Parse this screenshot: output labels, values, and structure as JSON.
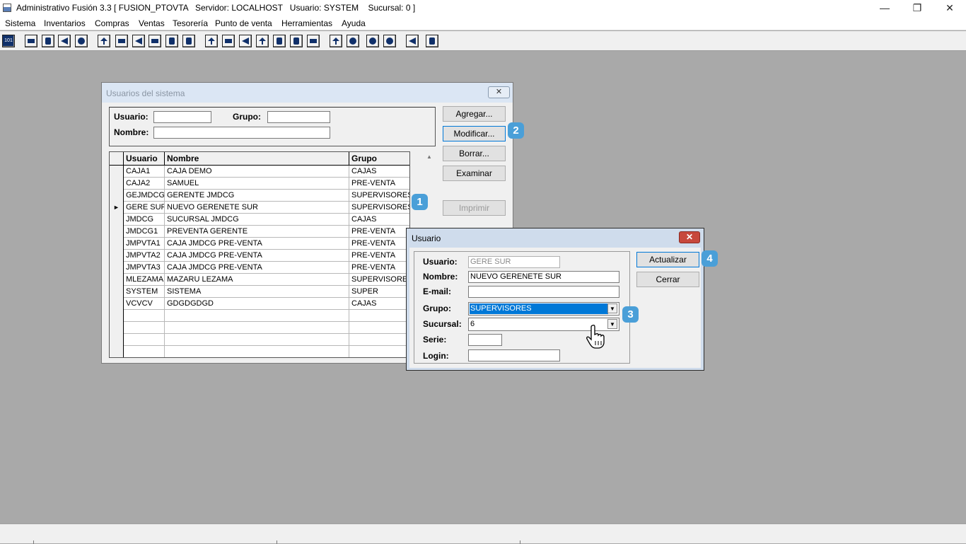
{
  "app": {
    "title": "Administrativo Fusión 3.3 [ FUSION_PTOVTA   Servidor: LOCALHOST   Usuario: SYSTEM    Sucursal: 0 ]",
    "window_controls": {
      "minimize": "—",
      "restore": "❐",
      "close": "✕"
    }
  },
  "menu": [
    "Sistema",
    "Inventarios",
    "Compras",
    "Ventas",
    "Tesorería",
    "Punto de venta",
    "Herramientas",
    "Ayuda"
  ],
  "toolbar": {
    "first_icon": "101"
  },
  "usuarios_window": {
    "title": "Usuarios del sistema",
    "close": "✕",
    "filter": {
      "usuario_label": "Usuario:",
      "usuario_value": "",
      "grupo_label": "Grupo:",
      "grupo_value": "",
      "nombre_label": "Nombre:",
      "nombre_value": ""
    },
    "buttons": {
      "agregar": "Agregar...",
      "modificar": "Modificar...",
      "borrar": "Borrar...",
      "examinar": "Examinar",
      "imprimir": "Imprimir"
    },
    "table": {
      "headers": [
        "Usuario",
        "Nombre",
        "Grupo"
      ],
      "rows": [
        [
          "CAJA1",
          "CAJA DEMO",
          "CAJAS"
        ],
        [
          "CAJA2",
          "SAMUEL",
          "PRE-VENTA"
        ],
        [
          "GEJMDCG",
          "GERENTE JMDCG",
          "SUPERVISORES"
        ],
        [
          "GERE SUR",
          "NUEVO GERENETE SUR",
          "SUPERVISORES"
        ],
        [
          "JMDCG",
          "SUCURSAL JMDCG",
          "CAJAS"
        ],
        [
          "JMDCG1",
          "PREVENTA GERENTE",
          "PRE-VENTA"
        ],
        [
          "JMPVTA1",
          "CAJA JMDCG PRE-VENTA",
          "PRE-VENTA"
        ],
        [
          "JMPVTA2",
          "CAJA JMDCG PRE-VENTA",
          "PRE-VENTA"
        ],
        [
          "JMPVTA3",
          "CAJA JMDCG PRE-VENTA",
          "PRE-VENTA"
        ],
        [
          "MLEZAMA",
          "MAZARU LEZAMA",
          "SUPERVISORES"
        ],
        [
          "SYSTEM",
          "SISTEMA",
          "SUPER"
        ],
        [
          "VCVCV",
          "GDGDGDGD",
          "CAJAS"
        ]
      ],
      "empty_rows": 4,
      "selected_index": 3,
      "current_row_marker": "►",
      "scroll_up": "▲"
    }
  },
  "usuario_dialog": {
    "title": "Usuario",
    "close": "✕",
    "fields": {
      "usuario_label": "Usuario:",
      "usuario_value": "GERE SUR",
      "nombre_label": "Nombre:",
      "nombre_value": "NUEVO GERENETE SUR",
      "email_label": "E-mail:",
      "email_value": "",
      "grupo_label": "Grupo:",
      "grupo_value": "SUPERVISORES",
      "sucursal_label": "Sucursal:",
      "sucursal_value": "6",
      "serie_label": "Serie:",
      "serie_value": "",
      "login_label": "Login:",
      "login_value": ""
    },
    "dropdown_arrow": "▼",
    "buttons": {
      "actualizar": "Actualizar",
      "cerrar": "Cerrar"
    }
  },
  "badges": [
    "1",
    "2",
    "3",
    "4"
  ],
  "colors": {
    "desktop": "#a9a9a9",
    "selection": "#0078d7",
    "badge": "#4a9fd8",
    "close_red": "#c7483c"
  }
}
